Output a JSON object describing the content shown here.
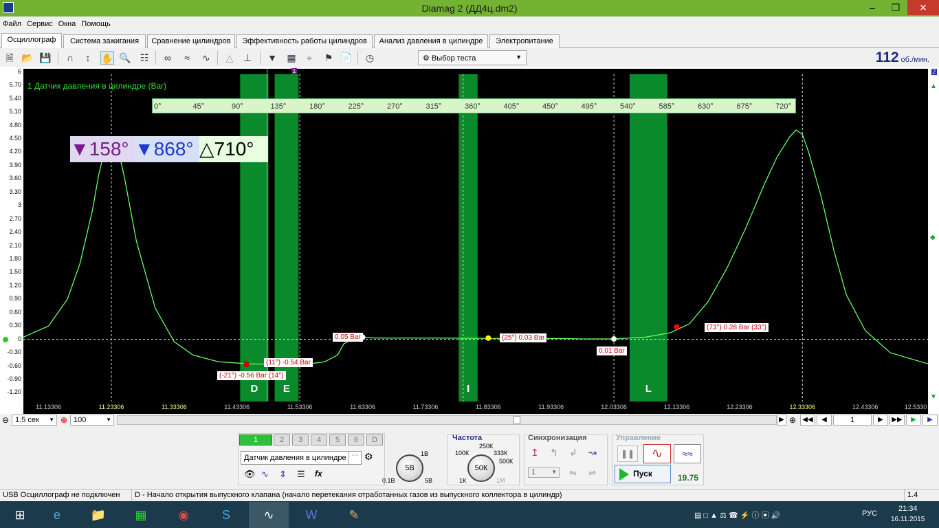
{
  "window": {
    "title": "Diamag 2 (ДД4ц.dm2)"
  },
  "menu": [
    "Файл",
    "Сервис",
    "Окна",
    "Помощь"
  ],
  "tabs": [
    "Осциллограф",
    "Система зажигания",
    "Сравнение цилиндров",
    "Эффективность работы цилиндров",
    "Анализ давления в цилиндре",
    "Электропитание"
  ],
  "toolbar": {
    "test_select": "Выбор теста",
    "rpm_value": "112",
    "rpm_unit": "об./мин."
  },
  "plot": {
    "trace_label": "1 Датчик давления в цилиндре (Bar)",
    "y_ticks": [
      "6",
      "5.70",
      "5.40",
      "5.10",
      "4.80",
      "4.50",
      "4.20",
      "3.90",
      "3.60",
      "3.30",
      "3",
      "2.70",
      "2.40",
      "2.10",
      "1.80",
      "1.50",
      "1.20",
      "0.90",
      "0.60",
      "0.30",
      "0",
      "-0.30",
      "-0.60",
      "-0.90",
      "-1.20"
    ],
    "x_ticks": [
      "11.13306",
      "11.23306",
      "11.33306",
      "11.43306",
      "11.53306",
      "11.63306",
      "11.73306",
      "11.83306",
      "11.93306",
      "12.03306",
      "12.13306",
      "12.23306",
      "12.33306",
      "12.43306",
      "12.5330"
    ],
    "deg_ticks": [
      "0°",
      "45°",
      "90°",
      "135°",
      "180°",
      "225°",
      "270°",
      "315°",
      "360°",
      "405°",
      "450°",
      "495°",
      "540°",
      "585°",
      "630°",
      "675°",
      "720°"
    ],
    "measure": {
      "c1": "158°",
      "c2": "868°",
      "delta": "710°"
    },
    "zones": [
      "D",
      "E",
      "I",
      "L"
    ],
    "annotations": [
      "0.05 Bar",
      "(11°) -0.54 Bar",
      "(-21°) -0.56 Bar (14°)",
      "(25°) 0.03 Bar",
      "0.01 Bar",
      "(73°) 0.28 Bar (33°)"
    ],
    "cursor_markers": [
      "1",
      "2"
    ]
  },
  "scroll": {
    "timebase": "1.5 сек",
    "zoom": "100",
    "page": "1"
  },
  "controls": {
    "channels": [
      "1",
      "2",
      "3",
      "4",
      "5",
      "6",
      "D"
    ],
    "sensor": "Датчик давления в цилиндре",
    "voltage": {
      "value": "5В",
      "labels": [
        "1В",
        "0.1В",
        "5В"
      ]
    },
    "freq": {
      "title": "Частота",
      "value": "50К",
      "labels": [
        "100К",
        "250К",
        "333К",
        "500К",
        "1К",
        "1М"
      ]
    },
    "sync": {
      "title": "Синхронизация",
      "value": "1"
    },
    "control": {
      "title": "Управление",
      "start": "Пуск",
      "value": "19.75"
    }
  },
  "status": {
    "usb": "USB Осциллограф не подключен",
    "message": "D - Начало открытия выпускного клапана (начало перетекания отработанных газов из выпускного коллектора в цилиндр)",
    "version": "1.4"
  },
  "taskbar": {
    "lang": "РУС",
    "time": "21:34",
    "date": "16.11.2015"
  },
  "chart_data": {
    "type": "line",
    "title": "1 Датчик давления в цилиндре (Bar)",
    "xlabel": "",
    "ylabel": "",
    "ylim": [
      -1.2,
      6
    ],
    "xlim": [
      11.09306,
      12.533
    ],
    "series": [
      {
        "name": "1 Датчик давления в цилиндре (Bar)",
        "x": [
          11.09306,
          11.13306,
          11.16306,
          11.18306,
          11.20306,
          11.21306,
          11.22306,
          11.23306,
          11.24306,
          11.25306,
          11.27306,
          11.30306,
          11.33306,
          11.36306,
          11.40306,
          11.45306,
          11.50306,
          11.53306,
          11.55306,
          11.57306,
          11.59306,
          11.60306,
          11.62306,
          11.65306,
          11.75306,
          11.85306,
          11.95306,
          11.98306,
          12.03306,
          12.08306,
          12.12306,
          12.15306,
          12.18306,
          12.21306,
          12.24306,
          12.27306,
          12.29306,
          12.31306,
          12.32306,
          12.33306,
          12.34306,
          12.36306,
          12.38306,
          12.40306,
          12.43306,
          12.47306,
          12.53306
        ],
        "values": [
          0.05,
          0.3,
          0.9,
          1.7,
          2.9,
          3.7,
          4.3,
          4.45,
          4.3,
          3.7,
          2.2,
          0.7,
          -0.05,
          -0.35,
          -0.5,
          -0.55,
          -0.56,
          -0.55,
          -0.54,
          -0.5,
          -0.35,
          -0.1,
          0.05,
          0.03,
          0.03,
          0.02,
          0.02,
          0.01,
          0.01,
          0.05,
          0.15,
          0.35,
          0.85,
          1.6,
          2.5,
          3.5,
          4.1,
          4.55,
          4.7,
          4.6,
          4.2,
          3.2,
          2.0,
          1.0,
          0.2,
          -0.3,
          -0.55
        ]
      }
    ]
  }
}
